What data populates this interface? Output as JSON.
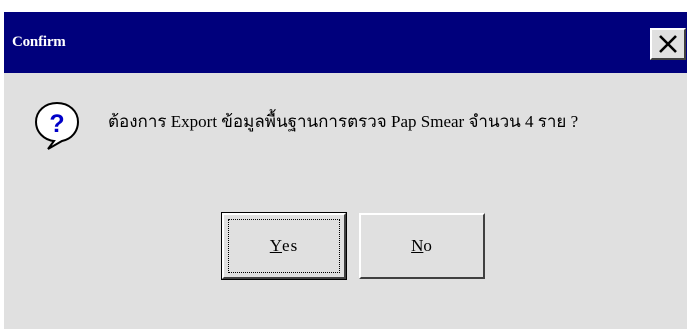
{
  "dialog": {
    "title": "Confirm",
    "message": "ต้องการ Export ข้อมูลพื้นฐานการตรวจ Pap Smear จำนวน 4 ราย ?",
    "icon": "question-icon",
    "buttons": {
      "yes": {
        "accel": "Y",
        "rest": "es"
      },
      "no": {
        "accel": "N",
        "rest": "o"
      }
    }
  },
  "colors": {
    "titlebar": "#00007c",
    "face": "#e0e0e0",
    "icon_blue": "#0000c8"
  }
}
